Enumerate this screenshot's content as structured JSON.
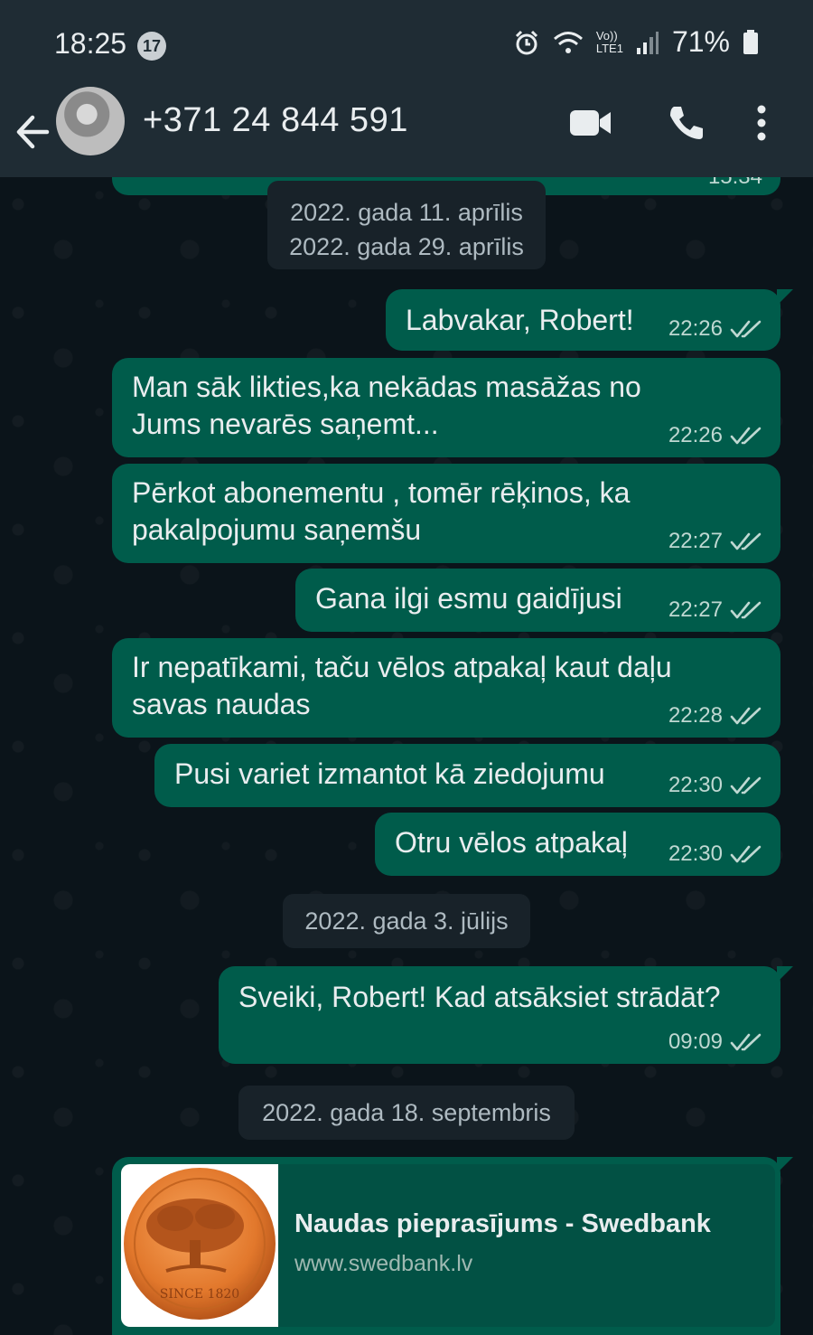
{
  "status_bar": {
    "time": "18:25",
    "notification_count": "17",
    "network_label_top": "Vo))",
    "network_label_bottom": "LTE1",
    "battery_percent": "71%"
  },
  "header": {
    "contact": "+371 24 844 591"
  },
  "date_chips": {
    "top_hidden": "2022. gada 11. aprīlis",
    "top": "2022. gada 29. aprīlis",
    "mid": "2022. gada 3. jūlijs",
    "bottom": "2022. gada 18. septembris"
  },
  "partial_time": "15:34",
  "messages": [
    {
      "text": "Labvakar, Robert!",
      "time": "22:26"
    },
    {
      "text": "Man sāk likties,ka nekādas masāžas no Jums nevarēs saņemt...",
      "time": "22:26"
    },
    {
      "text": "Pērkot abonementu , tomēr rēķinos, ka pakalpojumu saņemšu",
      "time": "22:27"
    },
    {
      "text": "Gana ilgi esmu gaidījusi",
      "time": "22:27"
    },
    {
      "text": "Ir nepatīkami, taču vēlos atpakaļ kaut daļu savas naudas",
      "time": "22:28"
    },
    {
      "text": "Pusi variet izmantot kā ziedojumu",
      "time": "22:30"
    },
    {
      "text": "Otru vēlos atpakaļ",
      "time": "22:30"
    },
    {
      "text": "Sveiki, Robert! Kad atsāksiet strādāt?",
      "time": "09:09"
    }
  ],
  "link_preview": {
    "title": "Naudas pieprasījums - Swedbank",
    "url": "www.swedbank.lv",
    "logo_text": "SINCE 1820"
  },
  "colors": {
    "outgoing_bubble": "#005c4b",
    "header_bg": "#1f2c34",
    "chat_bg": "#0b141a",
    "date_chip_bg": "#182229"
  }
}
